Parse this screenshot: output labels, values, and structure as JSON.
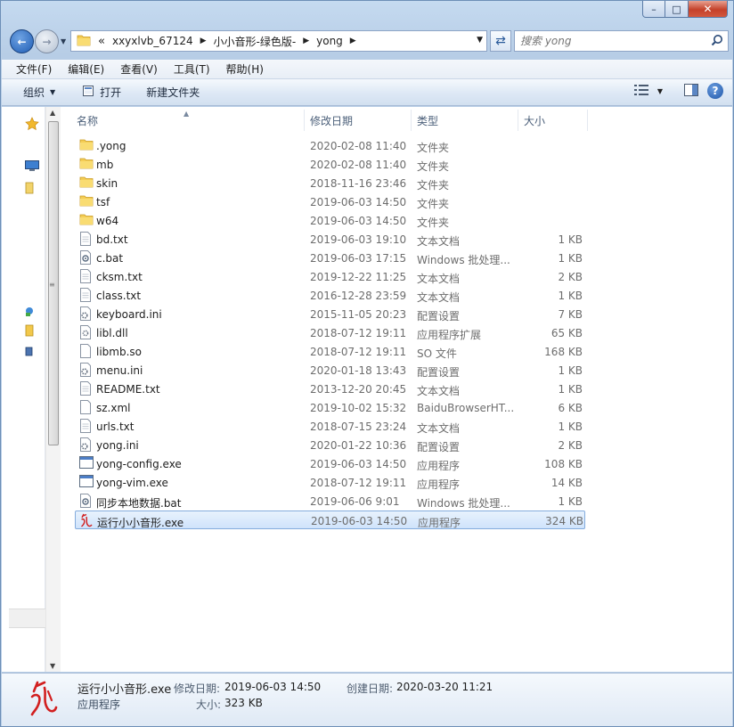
{
  "window": {
    "caption": {
      "minimize": "–",
      "maximize": "□",
      "close": "✕"
    }
  },
  "address": {
    "overflow": "«",
    "crumbs": [
      "xxyxlvb_67124",
      "小小音形-绿色版-",
      "yong"
    ]
  },
  "search": {
    "placeholder": "搜索 yong"
  },
  "menubar": [
    "文件(F)",
    "编辑(E)",
    "查看(V)",
    "工具(T)",
    "帮助(H)"
  ],
  "commands": {
    "organize": "组织",
    "open": "打开",
    "new_folder": "新建文件夹"
  },
  "columns": {
    "name": "名称",
    "date": "修改日期",
    "type": "类型",
    "size": "大小"
  },
  "files": [
    {
      "name": ".yong",
      "date": "2020-02-08 11:40",
      "type": "文件夹",
      "size": "",
      "icon": "folder-icon"
    },
    {
      "name": "mb",
      "date": "2020-02-08 11:40",
      "type": "文件夹",
      "size": "",
      "icon": "folder-icon"
    },
    {
      "name": "skin",
      "date": "2018-11-16 23:46",
      "type": "文件夹",
      "size": "",
      "icon": "folder-icon"
    },
    {
      "name": "tsf",
      "date": "2019-06-03 14:50",
      "type": "文件夹",
      "size": "",
      "icon": "folder-icon"
    },
    {
      "name": "w64",
      "date": "2019-06-03 14:50",
      "type": "文件夹",
      "size": "",
      "icon": "folder-icon"
    },
    {
      "name": "bd.txt",
      "date": "2019-06-03 19:10",
      "type": "文本文档",
      "size": "1 KB",
      "icon": "text-file-icon"
    },
    {
      "name": "c.bat",
      "date": "2019-06-03 17:15",
      "type": "Windows 批处理...",
      "size": "1 KB",
      "icon": "batch-file-icon"
    },
    {
      "name": "cksm.txt",
      "date": "2019-12-22 11:25",
      "type": "文本文档",
      "size": "2 KB",
      "icon": "text-file-icon"
    },
    {
      "name": "class.txt",
      "date": "2016-12-28 23:59",
      "type": "文本文档",
      "size": "1 KB",
      "icon": "text-file-icon"
    },
    {
      "name": "keyboard.ini",
      "date": "2015-11-05 20:23",
      "type": "配置设置",
      "size": "7 KB",
      "icon": "settings-file-icon"
    },
    {
      "name": "libl.dll",
      "date": "2018-07-12 19:11",
      "type": "应用程序扩展",
      "size": "65 KB",
      "icon": "dll-file-icon"
    },
    {
      "name": "libmb.so",
      "date": "2018-07-12 19:11",
      "type": "SO 文件",
      "size": "168 KB",
      "icon": "blank-file-icon"
    },
    {
      "name": "menu.ini",
      "date": "2020-01-18 13:43",
      "type": "配置设置",
      "size": "1 KB",
      "icon": "settings-file-icon"
    },
    {
      "name": "README.txt",
      "date": "2013-12-20 20:45",
      "type": "文本文档",
      "size": "1 KB",
      "icon": "text-file-icon"
    },
    {
      "name": "sz.xml",
      "date": "2019-10-02 15:32",
      "type": "BaiduBrowserHT...",
      "size": "6 KB",
      "icon": "blank-file-icon"
    },
    {
      "name": "urls.txt",
      "date": "2018-07-15 23:24",
      "type": "文本文档",
      "size": "1 KB",
      "icon": "text-file-icon"
    },
    {
      "name": "yong.ini",
      "date": "2020-01-22 10:36",
      "type": "配置设置",
      "size": "2 KB",
      "icon": "settings-file-icon"
    },
    {
      "name": "yong-config.exe",
      "date": "2019-06-03 14:50",
      "type": "应用程序",
      "size": "108 KB",
      "icon": "exe-file-icon"
    },
    {
      "name": "yong-vim.exe",
      "date": "2018-07-12 19:11",
      "type": "应用程序",
      "size": "14 KB",
      "icon": "exe-file-icon"
    },
    {
      "name": "同步本地数据.bat",
      "date": "2019-06-06 9:01",
      "type": "Windows 批处理...",
      "size": "1 KB",
      "icon": "batch-file-icon"
    },
    {
      "name": "运行小小音形.exe",
      "date": "2019-06-03 14:50",
      "type": "应用程序",
      "size": "324 KB",
      "icon": "yong-app-icon",
      "selected": true
    }
  ],
  "details": {
    "name": "运行小小音形.exe",
    "type": "应用程序",
    "modified_label": "修改日期:",
    "modified_value": "2019-06-03 14:50",
    "created_label": "创建日期:",
    "created_value": "2020-03-20 11:21",
    "size_label": "大小:",
    "size_value": "323 KB"
  },
  "colors": {
    "selection_bg": "#cfe3fb",
    "selection_border": "#84acdd",
    "accent": "#1f5db4"
  }
}
